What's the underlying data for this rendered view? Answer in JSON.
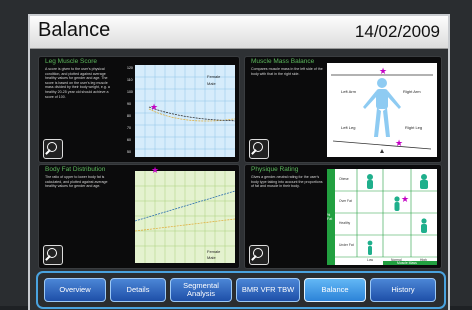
{
  "header": {
    "title": "Balance",
    "date": "14/02/2009"
  },
  "panels": {
    "leg_muscle": {
      "title": "Leg Muscle Score",
      "description": "A score is given to the user's physical condition, and plotted against average healthy values for gender and age. The score is based on the user's leg muscle mass divided by their body weight, e.g. a healthy 20-25 year old should achieve a score of 100.",
      "y_ticks": [
        "120",
        "110",
        "100",
        "90",
        "80",
        "70",
        "60",
        "50"
      ],
      "legend": {
        "female": "Female",
        "male": "Male"
      }
    },
    "muscle_mass_balance": {
      "title": "Muscle Mass Balance",
      "description": "Compares muscle mass in the left side of the body with that in the right side.",
      "labels": {
        "left_arm": "Left Arm",
        "right_arm": "Right Arm",
        "left_leg": "Left Leg",
        "right_leg": "Right Leg"
      }
    },
    "body_fat": {
      "title": "Body Fat Distribution",
      "description": "The ratio of upper to lower body fat is calculated, and plotted against average healthy values for gender and age.",
      "legend": {
        "female": "Female",
        "male": "Male"
      }
    },
    "physique": {
      "title": "Physique Rating",
      "description": "Gives a gender-neutral rating for the user's body type taking into account the proportions of fat and muscle in their body.",
      "side_label": "% Fat",
      "bottom_label": "Muscle Mass",
      "row_labels": [
        "Obese",
        "Over Fat",
        "Healthy",
        "Under Fat"
      ],
      "col_labels": [
        "Low",
        "Normal",
        "High"
      ]
    }
  },
  "nav": {
    "items": [
      {
        "label": "Overview"
      },
      {
        "label": "Details"
      },
      {
        "label": "Segmental Analysis"
      },
      {
        "label": "BMR VFR TBW"
      },
      {
        "label": "Balance"
      },
      {
        "label": "History"
      }
    ],
    "active_index": 4
  },
  "colors": {
    "accent_green": "#5cb85c",
    "nav_blue": "#2b64c2",
    "nav_active": "#46a4ee",
    "marker": "#c400c4"
  },
  "icons": [
    "zoom-in-icon",
    "star-marker-icon",
    "body-figure-icon"
  ]
}
